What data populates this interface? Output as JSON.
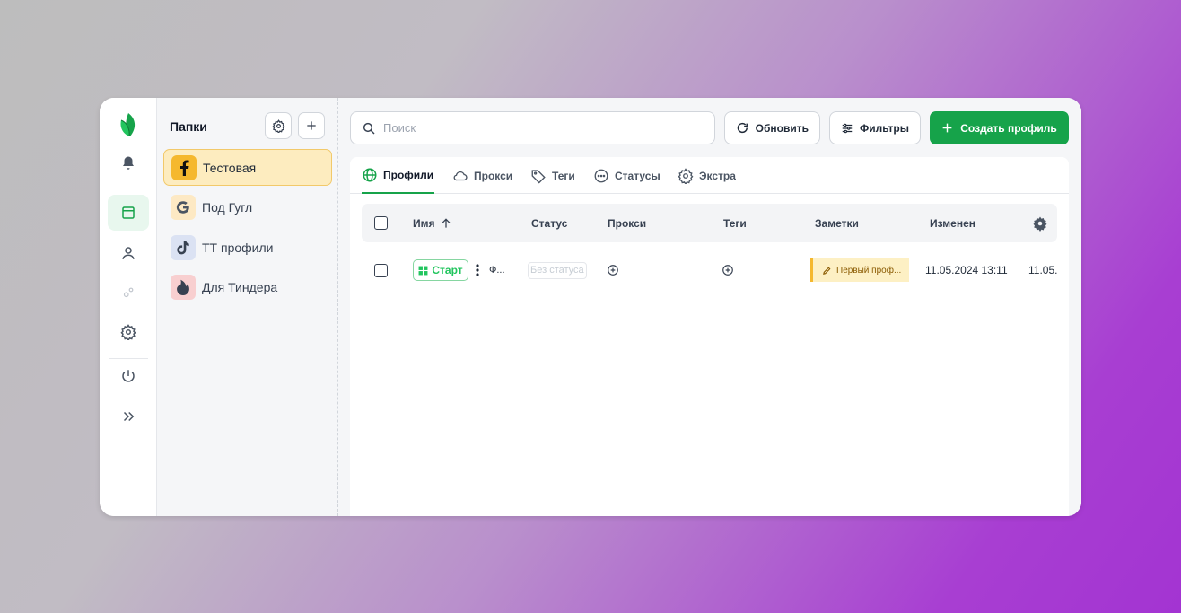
{
  "colors": {
    "accent": "#16a34a",
    "active_folder_bg": "#fdecbf",
    "note_bg": "#fdf0c4"
  },
  "rail": {
    "items": [
      {
        "icon": "leaf-logo-icon"
      },
      {
        "icon": "bell-icon"
      },
      {
        "icon": "browser-window-icon",
        "active": true
      },
      {
        "icon": "user-icon"
      },
      {
        "icon": "gears-icon"
      },
      {
        "icon": "gear-icon"
      },
      {
        "icon": "power-icon"
      },
      {
        "icon": "chevrons-right-icon"
      }
    ]
  },
  "folders": {
    "title": "Папки",
    "items": [
      {
        "label": "Тестовая",
        "icon": "facebook-icon",
        "active": true
      },
      {
        "label": "Под Гугл",
        "icon": "google-icon"
      },
      {
        "label": "ТТ профили",
        "icon": "tiktok-icon"
      },
      {
        "label": "Для Тиндера",
        "icon": "tinder-icon"
      }
    ]
  },
  "toolbar": {
    "search_placeholder": "Поиск",
    "refresh_label": "Обновить",
    "filters_label": "Фильтры",
    "create_label": "Создать профиль"
  },
  "tabs": [
    {
      "label": "Профили",
      "icon": "globe-icon",
      "active": true
    },
    {
      "label": "Прокси",
      "icon": "cloud-icon"
    },
    {
      "label": "Теги",
      "icon": "tag-icon"
    },
    {
      "label": "Статусы",
      "icon": "dots-circle-icon"
    },
    {
      "label": "Экстра",
      "icon": "gear-icon"
    }
  ],
  "table": {
    "columns": [
      "Имя",
      "Статус",
      "Прокси",
      "Теги",
      "Заметки",
      "Изменен"
    ],
    "rows": [
      {
        "start_label": "Старт",
        "name": "Ф...",
        "status": "Без статуса",
        "note": "Первый проф...",
        "modified": "11.05.2024 13:11",
        "extra": "11.05."
      }
    ]
  }
}
